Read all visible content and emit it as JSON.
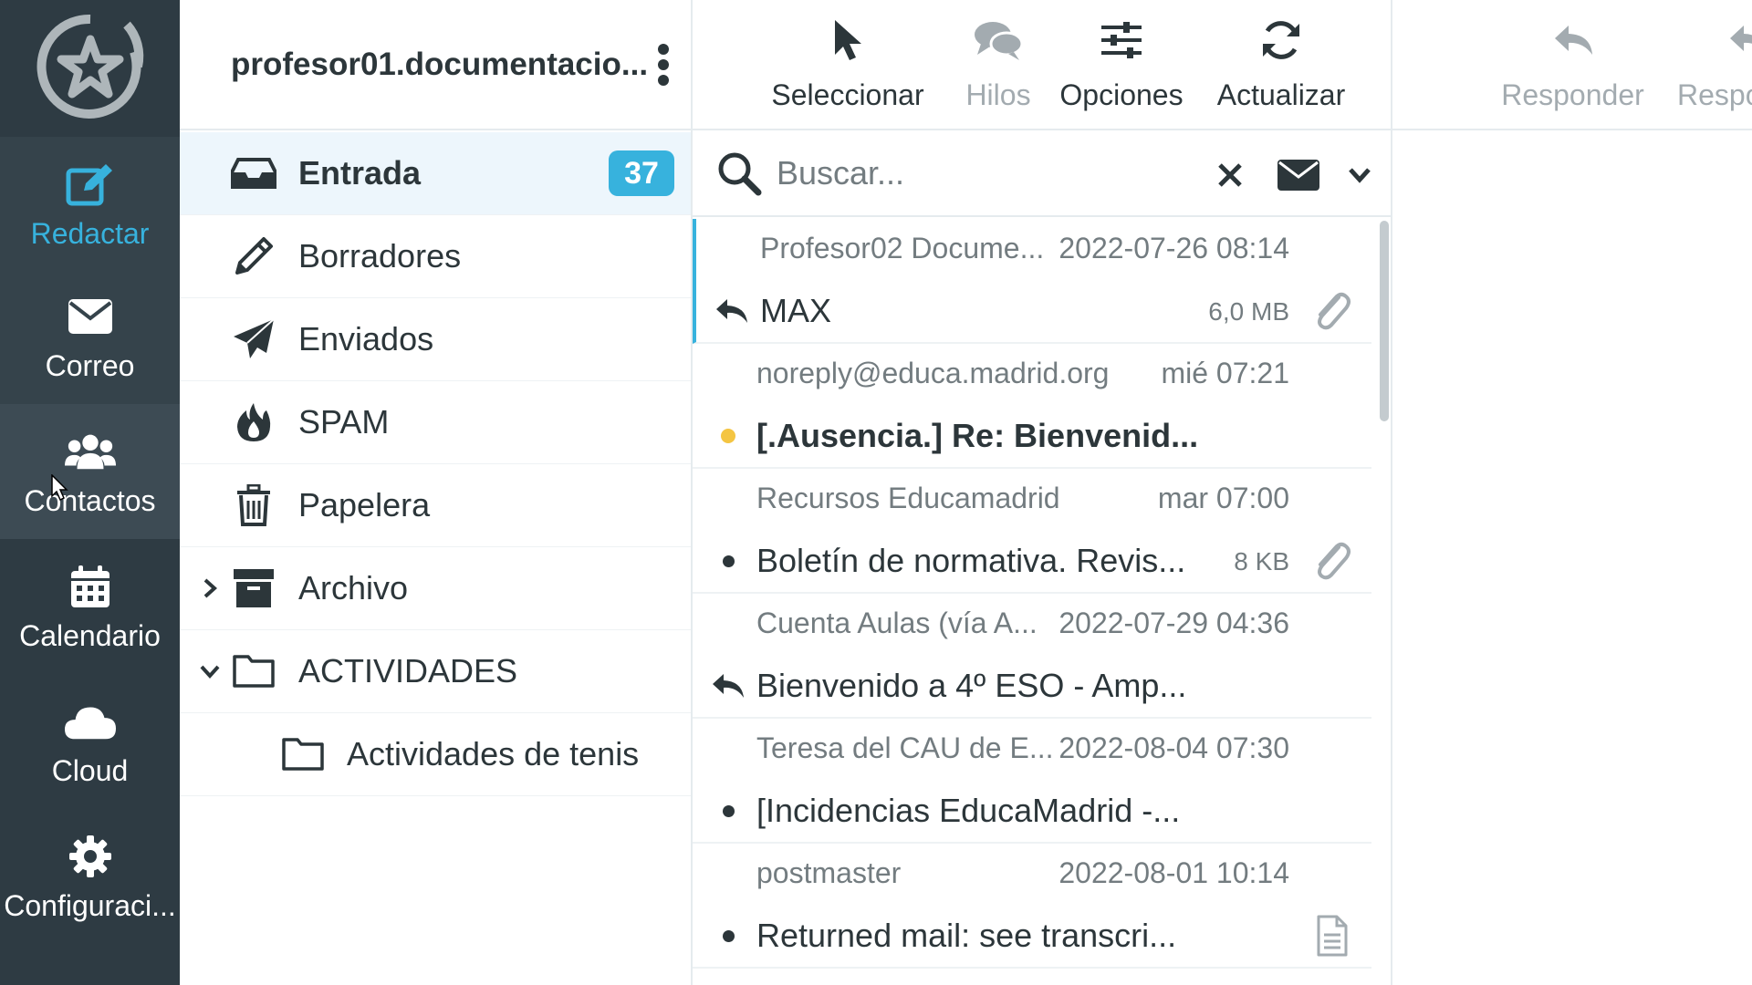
{
  "nav": {
    "items": [
      {
        "label": "Redactar",
        "icon": "compose-icon"
      },
      {
        "label": "Correo",
        "icon": "envelope-icon"
      },
      {
        "label": "Contactos",
        "icon": "users-icon"
      },
      {
        "label": "Calendario",
        "icon": "calendar-icon"
      },
      {
        "label": "Cloud",
        "icon": "cloud-icon"
      },
      {
        "label": "Configuraci...",
        "icon": "gear-icon"
      }
    ],
    "accent": "#37b2dd",
    "background": "#2e3b43"
  },
  "folders": {
    "account": "profesor01.documentacio...",
    "items": [
      {
        "label": "Entrada",
        "icon": "inbox-icon",
        "badge": "37"
      },
      {
        "label": "Borradores",
        "icon": "pencil-icon"
      },
      {
        "label": "Enviados",
        "icon": "paper-plane-icon"
      },
      {
        "label": "SPAM",
        "icon": "fire-icon"
      },
      {
        "label": "Papelera",
        "icon": "trash-icon"
      },
      {
        "label": "Archivo",
        "icon": "archive-icon"
      },
      {
        "label": "ACTIVIDADES",
        "icon": "folder-icon"
      },
      {
        "label": "Actividades de tenis",
        "icon": "folder-icon"
      }
    ]
  },
  "toolbar": {
    "select": "Seleccionar",
    "threads": "Hilos",
    "options": "Opciones",
    "refresh": "Actualizar",
    "reply": "Responder",
    "reply_all": "Respo"
  },
  "search": {
    "placeholder": "Buscar..."
  },
  "messages": [
    {
      "from": "Profesor02 Docume...",
      "date": "2022-07-26 08:14",
      "subject": "MAX",
      "size": "6,0 MB",
      "status": "replied-icon",
      "attachment": true,
      "unread": false
    },
    {
      "from": "noreply@educa.madrid.org",
      "date": "mié 07:21",
      "subject": "[.Ausencia.] Re: Bienvenid...",
      "size": "",
      "status": "flag-dot",
      "attachment": false,
      "unread": true
    },
    {
      "from": "Recursos Educamadrid",
      "date": "mar 07:00",
      "subject": "Boletín de normativa. Revis...",
      "size": "8 KB",
      "status": "dot",
      "attachment": true,
      "unread": false
    },
    {
      "from": "Cuenta Aulas (vía A...",
      "date": "2022-07-29 04:36",
      "subject": "Bienvenido a 4º ESO - Amp...",
      "size": "",
      "status": "replied-icon",
      "attachment": false,
      "unread": false
    },
    {
      "from": "Teresa del CAU de E...",
      "date": "2022-08-04 07:30",
      "subject": "[Incidencias EducaMadrid -...",
      "size": "",
      "status": "dot",
      "attachment": false,
      "unread": false
    },
    {
      "from": "postmaster",
      "date": "2022-08-01 10:14",
      "subject": "Returned mail: see transcri...",
      "size": "",
      "status": "dot",
      "attachment": false,
      "document": true,
      "unread": false
    }
  ]
}
